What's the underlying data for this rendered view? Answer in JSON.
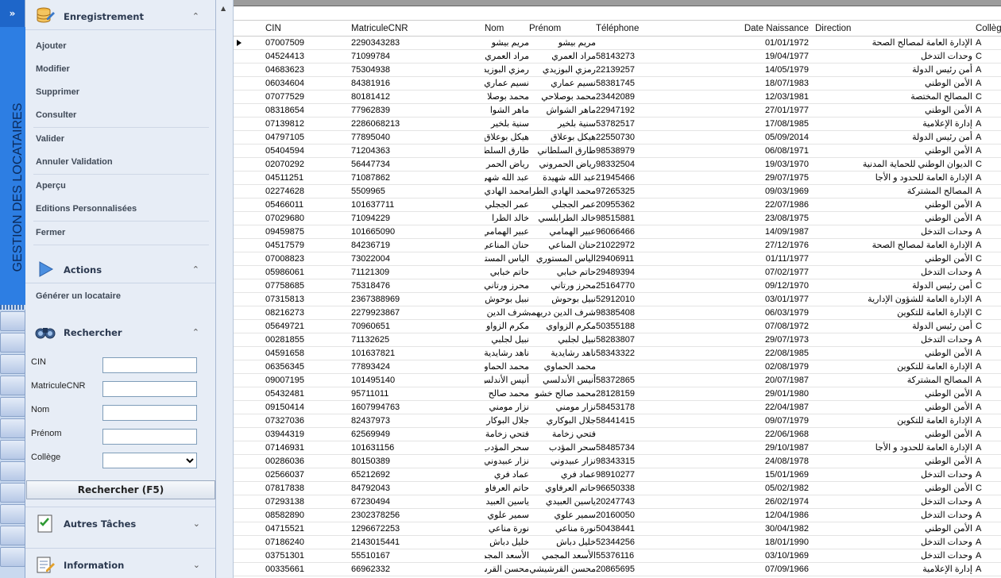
{
  "vertical_bar": {
    "expand_glyph": "»",
    "title": "GESTION DES LOCATAIRES"
  },
  "sidebar": {
    "group1": {
      "title": "Enregistrement",
      "chev": "⌃"
    },
    "group1_items": [
      "Ajouter",
      "Modifier",
      "Supprimer",
      "Consulter",
      "Valider",
      "Annuler Validation",
      "Aperçu",
      "Editions Personnalisées",
      "Fermer"
    ],
    "group2": {
      "title": "Actions",
      "chev": "⌃"
    },
    "group2_items": [
      "Générer un locataire"
    ],
    "group3": {
      "title": "Rechercher",
      "chev": "⌃"
    },
    "search_fields": {
      "cin": "CIN",
      "matricule": "MatriculeCNR",
      "nom": "Nom",
      "prenom": "Prénom",
      "college": "Collège"
    },
    "search_button": "Rechercher (F5)",
    "group4": {
      "title": "Autres Tâches",
      "chev": "⌄"
    },
    "group5": {
      "title": "Information",
      "chev": "⌄"
    }
  },
  "grid": {
    "columns": [
      "CIN",
      "MatriculeCNR",
      "Nom",
      "Prénom",
      "Téléphone",
      "Date Naissance",
      "Direction",
      "Collège"
    ],
    "rows": [
      [
        "07007509",
        "2290343283",
        "مريم بيشو",
        "مريم بيشو",
        "",
        "01/01/1972",
        "الإدارة العامة لمصالح الصحة",
        "A"
      ],
      [
        "04524413",
        "71099784",
        "مراد العمري",
        "مراد العمري",
        "58143273",
        "19/04/1977",
        "وحدات التدخل",
        "C"
      ],
      [
        "04683623",
        "75304938",
        "رمزي البوزيد",
        "رمزي البوزيدي",
        "22139257",
        "14/05/1979",
        "أمن رئيس الدولة",
        "A"
      ],
      [
        "06034604",
        "84381916",
        "نسيم عماري",
        "نسيم عماري",
        "58381745",
        "18/07/1983",
        "الأمن الوطني",
        "A"
      ],
      [
        "07077529",
        "80181412",
        "محمد بوصلا",
        "محمد بوصلاحي",
        "23442089",
        "12/03/1981",
        "المصالح المختصة",
        "C"
      ],
      [
        "08318654",
        "77962839",
        "ماهر الشوا",
        "ماهر الشواش",
        "22947192",
        "27/01/1977",
        "الأمن الوطني",
        "A"
      ],
      [
        "07139812",
        "2286068213",
        "سنية بلخير",
        "سنية بلخير",
        "53782517",
        "17/08/1985",
        "إدارة الإعلامية",
        "A"
      ],
      [
        "04797105",
        "77895040",
        "هيكل بوعلاق",
        "هيكل بوعلاق",
        "22550730",
        "05/09/2014",
        "أمن رئيس الدولة",
        "A"
      ],
      [
        "05404594",
        "71204363",
        "طارق السلطا",
        "طارق السلطاني",
        "98538979",
        "06/08/1971",
        "الأمن الوطني",
        "A"
      ],
      [
        "02070292",
        "56447734",
        "رياض الحمر",
        "رياض الحمروني",
        "98332504",
        "19/03/1970",
        "الديوان الوطني للحماية المدنية",
        "C"
      ],
      [
        "04511251",
        "71087862",
        "عبد الله شهي",
        "عبد الله شهيدة",
        "21945466",
        "29/07/1975",
        "الإدارة العامة للحدود و الأجا",
        "A"
      ],
      [
        "02274628",
        "5509965",
        "محمد الهادي",
        "محمد الهادي الطرابل",
        "97265325",
        "09/03/1969",
        "المصالح المشتركة",
        "A"
      ],
      [
        "05466011",
        "101637711",
        "عمر الججلي",
        "عمر الججلي",
        "20955362",
        "22/07/1986",
        "الأمن الوطني",
        "A"
      ],
      [
        "07029680",
        "71094229",
        "خالد الطرا",
        "خالد الطرابلسي",
        "98515881",
        "23/08/1975",
        "الأمن الوطني",
        "A"
      ],
      [
        "09459875",
        "101665090",
        "عبير الهمامي",
        "عبير الهمامي",
        "96066466",
        "14/09/1987",
        "وحدات التدخل",
        "A"
      ],
      [
        "04517579",
        "84236719",
        "حنان المناعي",
        "حنان المناعي",
        "21022972",
        "27/12/1976",
        "الإدارة العامة لمصالح الصحة",
        "A"
      ],
      [
        "07008823",
        "73022004",
        "الياس المستو",
        "الياس المستوري",
        "29406911",
        "01/11/1977",
        "الأمن الوطني",
        "C"
      ],
      [
        "05986061",
        "71121309",
        "حاتم خبابي",
        "حاتم خبابي",
        "29489394",
        "07/02/1977",
        "وحدات التدخل",
        "A"
      ],
      [
        "07758685",
        "75318476",
        "محرز ورتاني",
        "محرز ورتاني",
        "25164770",
        "09/12/1970",
        "أمن رئيس الدولة",
        "C"
      ],
      [
        "07315813",
        "2367388969",
        "نبيل بوحوش",
        "نبيل بوحوش",
        "52912010",
        "03/01/1977",
        "الإدارة العامة للشؤون الإدارية",
        "A"
      ],
      [
        "08216273",
        "2279923867",
        "شرف الدين",
        "شرف الدين دريهمي",
        "98385408",
        "06/03/1979",
        "الإدارة العامة للتكوين",
        "C"
      ],
      [
        "05649721",
        "70960651",
        "مكرم الزواو",
        "مكرم الزواوي",
        "50355188",
        "07/08/1972",
        "أمن رئيس الدولة",
        "C"
      ],
      [
        "00281855",
        "71132625",
        "نبيل لجلبي",
        "نبيل لجلبي",
        "58283807",
        "29/07/1973",
        "وحدات التدخل",
        "A"
      ],
      [
        "04591658",
        "101637821",
        "ناهد رشايدية",
        "ناهد رشايدية",
        "58343322",
        "22/08/1985",
        "الأمن الوطني",
        "A"
      ],
      [
        "06356345",
        "77893424",
        "محمد الحماو",
        "محمد الحماوي",
        "",
        "02/08/1979",
        "الإدارة العامة للتكوين",
        "A"
      ],
      [
        "09007195",
        "101495140",
        "أنيس الأندلس",
        "أنيس الأندلسي",
        "58372865",
        "20/07/1987",
        "المصالح المشتركة",
        "A"
      ],
      [
        "05432481",
        "95711011",
        "محمد صالح",
        "محمد صالح خشو",
        "28128159",
        "29/01/1980",
        "الأمن الوطني",
        "A"
      ],
      [
        "09150414",
        "1607994763",
        "نزار مومني",
        "نزار مومني",
        "58453178",
        "22/04/1987",
        "الأمن الوطني",
        "A"
      ],
      [
        "07327036",
        "82437973",
        "جلال البوكار",
        "جلال البوكاري",
        "58441415",
        "09/07/1979",
        "الإدارة العامة للتكوين",
        "A"
      ],
      [
        "03944319",
        "62569949",
        "فتحي زخامة",
        "فتحي زخامة",
        "",
        "22/06/1968",
        "الأمن الوطني",
        "A"
      ],
      [
        "07146931",
        "101631156",
        "سحر المؤدب",
        "سحر المؤدب",
        "58485734",
        "29/10/1987",
        "الإدارة العامة للحدود و الأجا",
        "A"
      ],
      [
        "00286036",
        "80150389",
        "نزار عبيدوني",
        "نزار عبيدوني",
        "98343315",
        "24/08/1978",
        "الأمن الوطني",
        "A"
      ],
      [
        "02566037",
        "65212692",
        "عماد فري",
        "عماد فري",
        "98910277",
        "15/01/1969",
        "وحدات التدخل",
        "A"
      ],
      [
        "07817838",
        "84792043",
        "حاتم العرفاو",
        "حاتم العرفاوي",
        "96650338",
        "05/02/1982",
        "الأمن الوطني",
        "C"
      ],
      [
        "07293138",
        "67230494",
        "ياسين العبيد",
        "ياسين العبيدي",
        "20247743",
        "26/02/1974",
        "وحدات التدخل",
        "A"
      ],
      [
        "08582890",
        "2302378256",
        "سمير علوي",
        "سمير علوي",
        "20160050",
        "12/04/1986",
        "وحدات التدخل",
        "A"
      ],
      [
        "04715521",
        "1296672253",
        "نورة مناعي",
        "نورة مناعي",
        "50438441",
        "30/04/1982",
        "الأمن الوطني",
        "A"
      ],
      [
        "07186240",
        "2143015441",
        "خليل دباش",
        "خليل دباش",
        "52344256",
        "18/01/1990",
        "وحدات التدخل",
        "A"
      ],
      [
        "03751301",
        "55510167",
        "الأسعد المجم",
        "الأسعد المجمي",
        "55376116",
        "03/10/1969",
        "وحدات التدخل",
        "A"
      ],
      [
        "00335661",
        "66962332",
        "محسن القرش",
        "محسن القرشيشي",
        "20865695",
        "07/09/1966",
        "إدارة الإعلامية",
        "A"
      ]
    ]
  }
}
